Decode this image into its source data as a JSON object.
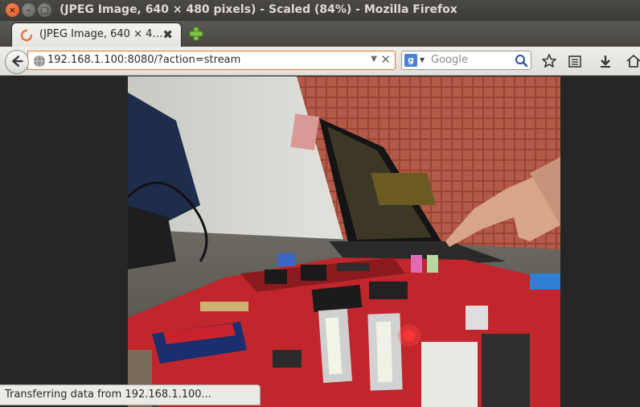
{
  "window": {
    "title": "(JPEG Image, 640 × 480 pixels) - Scaled (84%) - Mozilla Firefox",
    "close_glyph": "×",
    "minimize_glyph": "–",
    "maximize_glyph": "□"
  },
  "tab": {
    "label": "(JPEG Image, 640 × 4…",
    "close_glyph": "✖",
    "favicon": "firefox-spinner-icon"
  },
  "navbar": {
    "url": "192.168.1.100:8080/?action=stream",
    "url_dropdown": "▼",
    "url_clear": "✕",
    "search_engine": "g",
    "search_placeholder": "Google",
    "icons": [
      "back-icon",
      "globe-icon",
      "search-go-icon",
      "bookmark-star-icon",
      "reading-list-icon",
      "download-icon",
      "home-icon"
    ]
  },
  "status": {
    "text": "Transferring data from 192.168.1.100..."
  },
  "colors": {
    "urlbar_focus": "#e2792c",
    "board_red": "#c0262c",
    "wall_brick": "#9a4436"
  }
}
